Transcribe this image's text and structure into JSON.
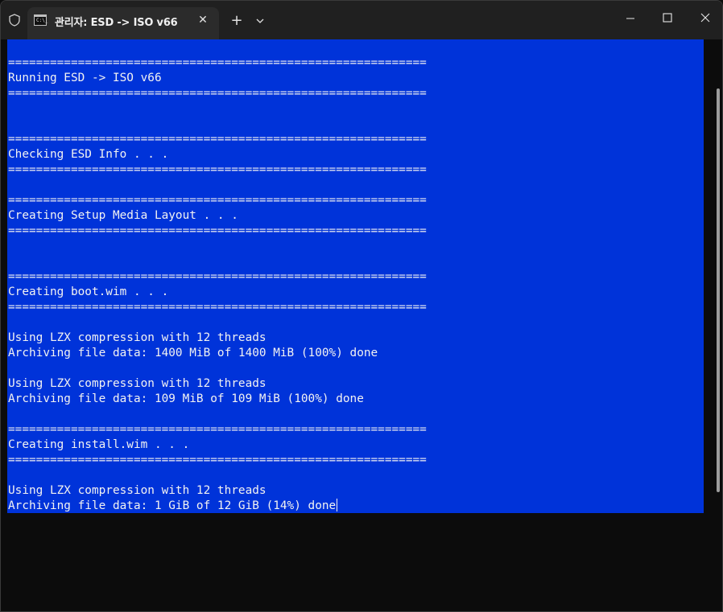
{
  "tab": {
    "title": "관리자:  ESD -> ISO v66",
    "close_glyph": "✕",
    "new_tab_glyph": "+",
    "icon_text": "C:\\_"
  },
  "window_controls": {
    "minimize": "minimize-icon",
    "maximize": "maximize-icon",
    "close": "close-icon"
  },
  "colors": {
    "console_bg": "#0033d9",
    "console_fg": "#f2f2f2",
    "titlebar": "#202020"
  },
  "console": {
    "lines": [
      "============================================================",
      "Running ESD -> ISO v66",
      "============================================================",
      "",
      "",
      "============================================================",
      "Checking ESD Info . . .",
      "============================================================",
      "",
      "============================================================",
      "Creating Setup Media Layout . . .",
      "============================================================",
      "",
      "",
      "============================================================",
      "Creating boot.wim . . .",
      "============================================================",
      "",
      "Using LZX compression with 12 threads",
      "Archiving file data: 1400 MiB of 1400 MiB (100%) done",
      "",
      "Using LZX compression with 12 threads",
      "Archiving file data: 109 MiB of 109 MiB (100%) done",
      "",
      "============================================================",
      "Creating install.wim . . .",
      "============================================================",
      "",
      "Using LZX compression with 12 threads",
      "Archiving file data: 1 GiB of 12 GiB (14%) done"
    ]
  }
}
